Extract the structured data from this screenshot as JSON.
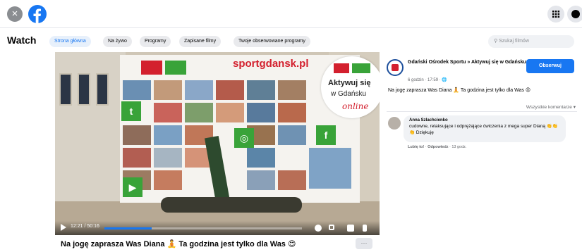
{
  "topbar": {
    "close_glyph": "×",
    "logo_icon": "facebook-logo",
    "menu_icon": "grid-menu-icon",
    "messenger_icon": "messenger-icon"
  },
  "watch": {
    "title": "Watch",
    "tabs": [
      "Strona główna",
      "Na żywo",
      "Programy",
      "Zapisane filmy",
      "Twoje obserwowane programy"
    ],
    "active_tab": "Strona główna",
    "search_placeholder": "Szukaj filmów"
  },
  "video": {
    "banner_url": "sportgdansk.pl",
    "badge": {
      "line1": "Aktywuj się",
      "line2": "w Gdańsku",
      "line3": "online"
    },
    "time": "12:21 / 50:16",
    "progress_fraction": 0.24,
    "title": "Na jogę zaprasza Was Diana 🧘 Ta godzina jest tylko dla Was 😍",
    "more_label": "···"
  },
  "post": {
    "page_name": "Gdański Ośrodek Sportu » Aktywuj się w Gdańsku",
    "time": "6 godzin · 17:59 · 🌐",
    "follow_label": "Obserwuj",
    "text": "Na jogę zaprasza Was Diana 🧘 Ta godzina jest tylko dla Was 😍",
    "all_comments": "Wszystkie komentarze ▾"
  },
  "comment": {
    "author": "Anna Szlachcienko",
    "text": "cudowne, relaksujące i odprężające ćwiczenia z mega super Dianą 👏👏👏 Dziękuję",
    "actions": {
      "like": "Lubię to!",
      "reply": "Odpowiedz",
      "time": "13 godz."
    }
  },
  "colors": {
    "brand": "#1877f2",
    "red": "#d3202e",
    "green": "#39a339"
  }
}
